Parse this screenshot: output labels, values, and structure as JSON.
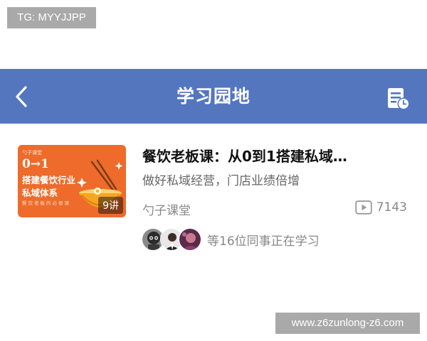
{
  "overlay": {
    "tg_label": "TG: MYYJJPP",
    "watermark": "www.z6zunlong-z6.com"
  },
  "navbar": {
    "title": "学习园地",
    "back_icon": "chevron-left-icon",
    "history_icon": "document-clock-icon",
    "background": "#5376bf"
  },
  "course": {
    "title": "餐饮老板课：从0到1搭建私域…",
    "subtitle": "做好私域经营，门店业绩倍增",
    "provider": "勺子课堂",
    "views": "7143",
    "views_icon": "play-video-icon",
    "thumbnail": {
      "brand_tag": "勺子课堂",
      "number_mark": "0→1",
      "line1": "搭建餐饮行业",
      "line2": "私域体系",
      "sub_line": "餐饮老板的必修课",
      "lessons_badge": "9讲",
      "background": "#ee6b2b"
    },
    "learners": {
      "text": "等16位同事正在学习",
      "avatars": [
        "avatar-1",
        "avatar-2",
        "avatar-3"
      ]
    }
  }
}
